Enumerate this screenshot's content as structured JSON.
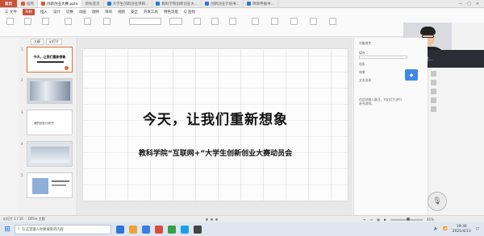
{
  "tabs": [
    {
      "label": "首页",
      "icon": "home-icon"
    },
    {
      "label": "稻壳",
      "icon": "wps-icon"
    },
    {
      "label": "创新创业大赛.pptx",
      "icon": "ppt-icon"
    },
    {
      "label": "新标签页",
      "icon": "blank-icon"
    },
    {
      "label": "大学生创新创业项目...",
      "icon": "doc-icon"
    },
    {
      "label": "教科学院创新创业大...",
      "icon": "doc-icon"
    },
    {
      "label": "创新创业计划书...",
      "icon": "doc-icon"
    },
    {
      "label": "项目申报书...",
      "icon": "doc-icon"
    }
  ],
  "menu": [
    "三 文件",
    "开始",
    "插入",
    "设计",
    "切换",
    "动画",
    "放映",
    "审阅",
    "视图",
    "安全",
    "开发工具",
    "特色功能",
    "Q 查找"
  ],
  "menu_active_index": 1,
  "left_panel": {
    "tabs": [
      "大纲",
      "幻灯片"
    ],
    "slide_numbers": [
      "1",
      "2",
      "3",
      "4",
      "5"
    ],
    "thumb1_title": "今天，让我们重新想象",
    "thumb3_title": "我的创业计划书"
  },
  "slide": {
    "title": "今天，让我们重新想象",
    "subtitle": "教科学院“互联网+”大学生创新创业大赛动员会"
  },
  "right_panel": {
    "lines": [
      "对象属性",
      "填充",
      "线条",
      "效果",
      "文本选项"
    ],
    "note": "在此处输入备注，对幻灯片进行补充说明。"
  },
  "video": {
    "user_name": "吴..."
  },
  "status": {
    "slide_counter": "幻灯片 1 / 16",
    "theme": "Office 主题",
    "zoom": "81%"
  },
  "taskbar": {
    "search_placeholder": "在这里输入你要搜索的内容",
    "time": "19:30",
    "date": "2021/4/13"
  }
}
